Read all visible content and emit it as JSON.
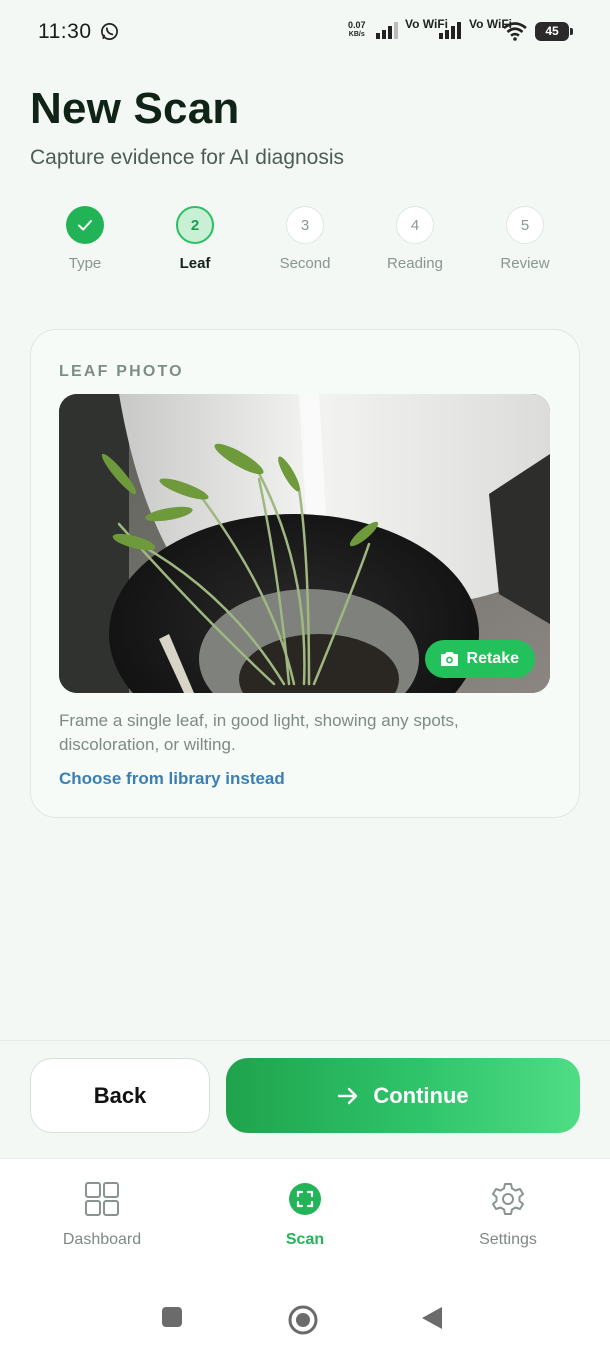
{
  "status_bar": {
    "time": "11:30",
    "net_speed_value": "0.07",
    "net_speed_unit": "KB/s",
    "sim1_label": "Vo WiFi",
    "sim2_label": "Vo WiFi",
    "battery": "45",
    "icons": [
      "whatsapp-icon",
      "signal-icon",
      "wifi-icon",
      "battery-icon"
    ]
  },
  "header": {
    "title": "New Scan",
    "subtitle": "Capture evidence for AI diagnosis"
  },
  "stepper": {
    "steps": [
      {
        "number": "✓",
        "label": "Type",
        "state": "done"
      },
      {
        "number": "2",
        "label": "Leaf",
        "state": "current"
      },
      {
        "number": "3",
        "label": "Second",
        "state": "todo"
      },
      {
        "number": "4",
        "label": "Reading",
        "state": "todo"
      },
      {
        "number": "5",
        "label": "Review",
        "state": "todo"
      }
    ]
  },
  "card": {
    "title": "LEAF PHOTO",
    "retake_label": "Retake",
    "hint": "Frame a single leaf, in good light, showing any spots, discoloration, or wilting.",
    "library_link": "Choose from library instead"
  },
  "actions": {
    "back_label": "Back",
    "continue_label": "Continue"
  },
  "bottom_nav": {
    "items": [
      {
        "label": "Dashboard",
        "icon": "grid-icon",
        "active": false
      },
      {
        "label": "Scan",
        "icon": "scan-icon",
        "active": true
      },
      {
        "label": "Settings",
        "icon": "gear-icon",
        "active": false
      }
    ]
  },
  "colors": {
    "accent": "#23b458",
    "background": "#f3f8f4",
    "title": "#0f2317",
    "link": "#3a7fb3"
  }
}
